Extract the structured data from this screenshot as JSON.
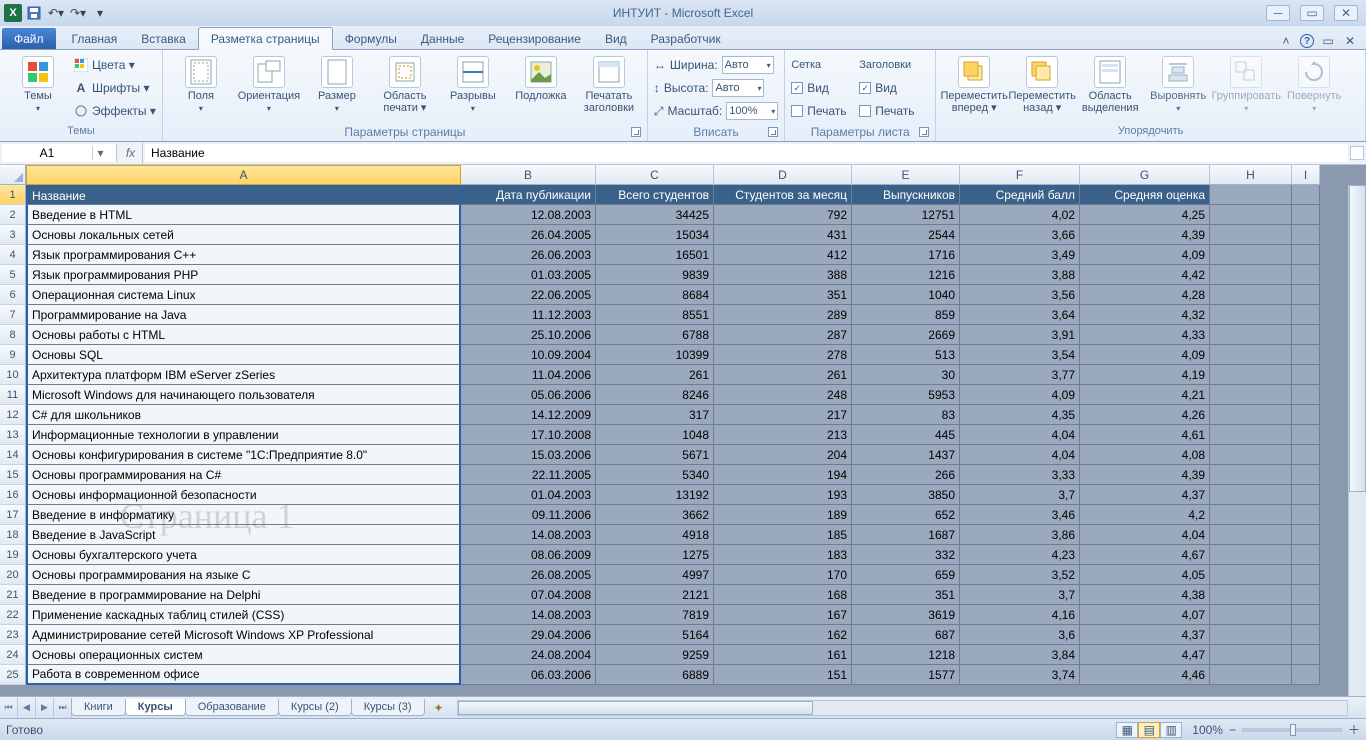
{
  "app": {
    "title": "ИНТУИТ  -  Microsoft Excel"
  },
  "tabs": {
    "file": "Файл",
    "items": [
      "Главная",
      "Вставка",
      "Разметка страницы",
      "Формулы",
      "Данные",
      "Рецензирование",
      "Вид",
      "Разработчик"
    ],
    "active": 2
  },
  "ribbon": {
    "themes": {
      "label": "Темы",
      "colors": "Цвета ▾",
      "fonts": "Шрифты ▾",
      "effects": "Эффекты ▾",
      "btn": "Темы"
    },
    "page": {
      "label": "Параметры страницы",
      "margins": "Поля",
      "orient": "Ориентация",
      "size": "Размер",
      "printarea": "Область печати ▾",
      "breaks": "Разрывы",
      "bg": "Подложка",
      "titles": "Печатать заголовки"
    },
    "fit": {
      "label": "Вписать",
      "width": "Ширина:",
      "height": "Высота:",
      "scale": "Масштаб:",
      "auto": "Авто",
      "pct": "100%"
    },
    "sheetopts": {
      "label": "Параметры листа",
      "grid": "Сетка",
      "headings": "Заголовки",
      "view": "Вид",
      "print": "Печать"
    },
    "arrange": {
      "label": "Упорядочить",
      "front": "Переместить вперед ▾",
      "back": "Переместить назад ▾",
      "pane": "Область выделения",
      "align": "Выровнять",
      "group": "Группировать",
      "rotate": "Повернуть"
    }
  },
  "fx": {
    "name": "A1",
    "formula": "Название"
  },
  "cols": [
    "A",
    "B",
    "C",
    "D",
    "E",
    "F",
    "G",
    "H",
    "I"
  ],
  "headers": [
    "Название",
    "Дата публикации",
    "Всего студентов",
    "Студентов за месяц",
    "Выпускников",
    "Средний балл",
    "Средняя оценка"
  ],
  "rows": [
    [
      "Введение в HTML",
      "12.08.2003",
      "34425",
      "792",
      "12751",
      "4,02",
      "4,25"
    ],
    [
      "Основы локальных сетей",
      "26.04.2005",
      "15034",
      "431",
      "2544",
      "3,66",
      "4,39"
    ],
    [
      "Язык программирования C++",
      "26.06.2003",
      "16501",
      "412",
      "1716",
      "3,49",
      "4,09"
    ],
    [
      "Язык программирования PHP",
      "01.03.2005",
      "9839",
      "388",
      "1216",
      "3,88",
      "4,42"
    ],
    [
      "Операционная система Linux",
      "22.06.2005",
      "8684",
      "351",
      "1040",
      "3,56",
      "4,28"
    ],
    [
      "Программирование на Java",
      "11.12.2003",
      "8551",
      "289",
      "859",
      "3,64",
      "4,32"
    ],
    [
      "Основы работы с HTML",
      "25.10.2006",
      "6788",
      "287",
      "2669",
      "3,91",
      "4,33"
    ],
    [
      "Основы SQL",
      "10.09.2004",
      "10399",
      "278",
      "513",
      "3,54",
      "4,09"
    ],
    [
      "Архитектура платформ IBM eServer zSeries",
      "11.04.2006",
      "261",
      "261",
      "30",
      "3,77",
      "4,19"
    ],
    [
      "Microsoft Windows для начинающего пользователя",
      "05.06.2006",
      "8246",
      "248",
      "5953",
      "4,09",
      "4,21"
    ],
    [
      "C# для школьников",
      "14.12.2009",
      "317",
      "217",
      "83",
      "4,35",
      "4,26"
    ],
    [
      "Информационные технологии в управлении",
      "17.10.2008",
      "1048",
      "213",
      "445",
      "4,04",
      "4,61"
    ],
    [
      "Основы конфигурирования в системе \"1С:Предприятие 8.0\"",
      "15.03.2006",
      "5671",
      "204",
      "1437",
      "4,04",
      "4,08"
    ],
    [
      "Основы программирования на C#",
      "22.11.2005",
      "5340",
      "194",
      "266",
      "3,33",
      "4,39"
    ],
    [
      "Основы информационной безопасности",
      "01.04.2003",
      "13192",
      "193",
      "3850",
      "3,7",
      "4,37"
    ],
    [
      "Введение в информатику",
      "09.11.2006",
      "3662",
      "189",
      "652",
      "3,46",
      "4,2"
    ],
    [
      "Введение в JavaScript",
      "14.08.2003",
      "4918",
      "185",
      "1687",
      "3,86",
      "4,04"
    ],
    [
      "Основы бухгалтерского учета",
      "08.06.2009",
      "1275",
      "183",
      "332",
      "4,23",
      "4,67"
    ],
    [
      "Основы программирования на языке C",
      "26.08.2005",
      "4997",
      "170",
      "659",
      "3,52",
      "4,05"
    ],
    [
      "Введение в программирование на Delphi",
      "07.04.2008",
      "2121",
      "168",
      "351",
      "3,7",
      "4,38"
    ],
    [
      "Применение каскадных таблиц стилей (CSS)",
      "14.08.2003",
      "7819",
      "167",
      "3619",
      "4,16",
      "4,07"
    ],
    [
      "Администрирование сетей Microsoft Windows XP Professional",
      "29.04.2006",
      "5164",
      "162",
      "687",
      "3,6",
      "4,37"
    ],
    [
      "Основы операционных систем",
      "24.08.2004",
      "9259",
      "161",
      "1218",
      "3,84",
      "4,47"
    ],
    [
      "Работа в современном офисе",
      "06.03.2006",
      "6889",
      "151",
      "1577",
      "3,74",
      "4,46"
    ]
  ],
  "watermark": "Страница  1",
  "sheets": {
    "items": [
      "Книги",
      "Курсы",
      "Образование",
      "Курсы (2)",
      "Курсы (3)"
    ],
    "active": 1
  },
  "status": {
    "ready": "Готово",
    "zoom": "100%"
  }
}
